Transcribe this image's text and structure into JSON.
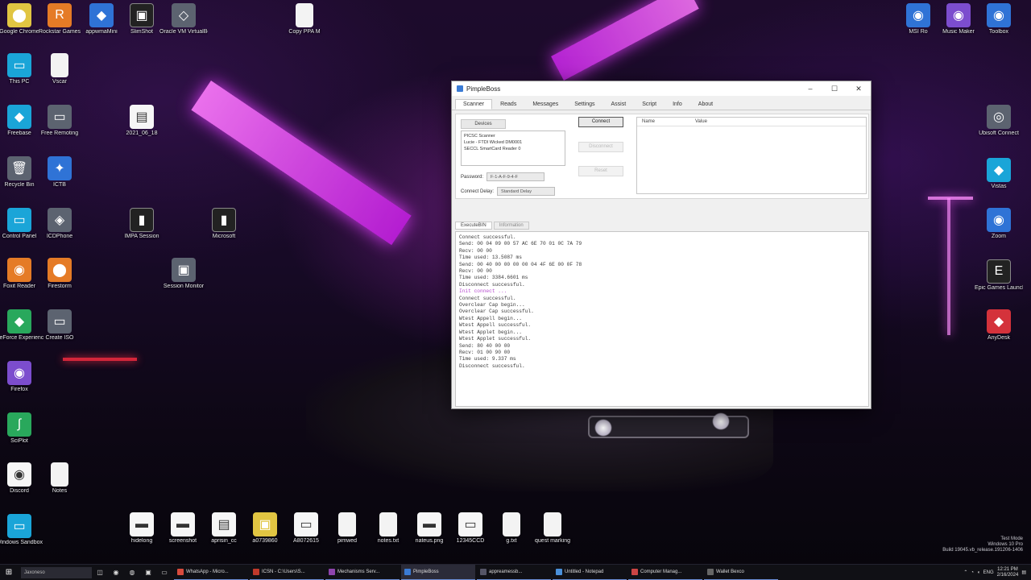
{
  "desktop": {
    "icons_left": [
      {
        "label": "Google Chrome",
        "glyph": "⬤",
        "color": "g-yellow"
      },
      {
        "label": "Rockstar Games",
        "glyph": "R",
        "color": "g-orange"
      },
      {
        "label": "appwmaMini",
        "glyph": "◆",
        "color": "g-blue"
      },
      {
        "label": "SlimShot",
        "glyph": "▣",
        "color": "g-dark"
      },
      {
        "label": "Oracle VM VirtualBox",
        "glyph": "◇",
        "color": "g-grey"
      },
      {
        "label": "This PC",
        "glyph": "▭",
        "color": "g-cyan"
      },
      {
        "label": "Vscar",
        "glyph": "",
        "color": "g-file"
      },
      {
        "label": "Freebase",
        "glyph": "◆",
        "color": "g-cyan"
      },
      {
        "label": "Free Remoting",
        "glyph": "▭",
        "color": "g-grey"
      },
      {
        "label": "2021_06_18",
        "glyph": "▤",
        "color": "g-white"
      },
      {
        "label": "Recycle Bin",
        "glyph": "🗑",
        "color": "g-grey"
      },
      {
        "label": "ICTB",
        "glyph": "✦",
        "color": "g-blue"
      },
      {
        "label": "Control Panel",
        "glyph": "▭",
        "color": "g-cyan"
      },
      {
        "label": "ICDPhone",
        "glyph": "◈",
        "color": "g-grey"
      },
      {
        "label": "IMPA Session",
        "glyph": "▮",
        "color": "g-dark"
      },
      {
        "label": "Microsoft",
        "glyph": "▮",
        "color": "g-dark"
      },
      {
        "label": "Foxit Reader",
        "glyph": "◉",
        "color": "g-orange"
      },
      {
        "label": "Firestorm",
        "glyph": "⬤",
        "color": "g-orange"
      },
      {
        "label": "Session Monitor",
        "glyph": "▣",
        "color": "g-grey"
      },
      {
        "label": "GeForce Experience",
        "glyph": "◆",
        "color": "g-green"
      },
      {
        "label": "Create ISO",
        "glyph": "▭",
        "color": "g-grey"
      },
      {
        "label": "Firefox",
        "glyph": "◉",
        "color": "g-purple"
      },
      {
        "label": "SciPlot",
        "glyph": "∫",
        "color": "g-green"
      },
      {
        "label": "Discord",
        "glyph": "◉",
        "color": "g-white"
      },
      {
        "label": "Notes",
        "glyph": "",
        "color": "g-file"
      },
      {
        "label": "Windows Sandbox",
        "glyph": "▭",
        "color": "g-cyan"
      },
      {
        "label": "Copy PPA M",
        "glyph": "",
        "color": "g-file"
      }
    ],
    "icons_right": [
      {
        "label": "MSI Ro",
        "glyph": "◉",
        "color": "g-blue"
      },
      {
        "label": "Music Maker",
        "glyph": "◉",
        "color": "g-purple"
      },
      {
        "label": "Toolbox",
        "glyph": "◉",
        "color": "g-blue"
      },
      {
        "label": "Ubisoft Connect",
        "glyph": "◎",
        "color": "g-grey"
      },
      {
        "label": "Vistas",
        "glyph": "◆",
        "color": "g-cyan"
      },
      {
        "label": "Zoom",
        "glyph": "◉",
        "color": "g-blue"
      },
      {
        "label": "Epic Games Launcher",
        "glyph": "E",
        "color": "g-dark"
      },
      {
        "label": "AnyDesk",
        "glyph": "◆",
        "color": "g-red"
      }
    ],
    "icons_bottom": [
      {
        "label": "hidelong",
        "glyph": "▬",
        "color": "g-white"
      },
      {
        "label": "screenshot",
        "glyph": "▬",
        "color": "g-white"
      },
      {
        "label": "aprisin_cc",
        "glyph": "▤",
        "color": "g-white"
      },
      {
        "label": "a0739860",
        "glyph": "▣",
        "color": "g-yellow"
      },
      {
        "label": "A8072615",
        "glyph": "▭",
        "color": "g-white"
      },
      {
        "label": "pimwed",
        "glyph": "",
        "color": "g-file"
      },
      {
        "label": "notes.txt",
        "glyph": "",
        "color": "g-file"
      },
      {
        "label": "nateus.png",
        "glyph": "▬",
        "color": "g-white"
      },
      {
        "label": "12345CCD",
        "glyph": "▭",
        "color": "g-white"
      },
      {
        "label": "g.txt",
        "glyph": "",
        "color": "g-file"
      },
      {
        "label": "quest marking",
        "glyph": "",
        "color": "g-file"
      }
    ]
  },
  "window": {
    "title": "PimpleBoss",
    "tabs": [
      "Scanner",
      "Reads",
      "Messages",
      "Settings",
      "Assist",
      "Script",
      "Info",
      "About"
    ],
    "subtab": "Devices",
    "device_list": [
      "PICSC Scanner",
      "Lucie - FTDI Wicked DM0001",
      "SECCL SmartCard Reader 0"
    ],
    "fields": [
      {
        "label": "Password:",
        "value": "F-1-A-F-9-4-F"
      },
      {
        "label": "Connect Delay:",
        "value": "Standard Delay"
      }
    ],
    "buttons": {
      "connect": "Connect",
      "ghost1": "Disconnect",
      "ghost2": "Reset"
    },
    "param_headers": [
      "Name",
      "Value"
    ],
    "log_tabs": [
      "ExecuteBIN",
      "Information"
    ],
    "log_lines": [
      {
        "text": "Connect successful.",
        "accent": false
      },
      {
        "text": "Send: 00 04 09 00 57 AC 6E 70 01 0C 7A 79",
        "accent": false
      },
      {
        "text": "Recv: 00 00",
        "accent": false
      },
      {
        "text": "Time used: 13.5087 ms",
        "accent": false
      },
      {
        "text": "Send: 00 40 00 00 00 00 04 4F 6E 00 0F 78",
        "accent": false
      },
      {
        "text": "Recv: 00 00",
        "accent": false
      },
      {
        "text": "Time used: 3384.6601 ms",
        "accent": false
      },
      {
        "text": "Disconnect successful.",
        "accent": false
      },
      {
        "text": "Init connect ...",
        "accent": true
      },
      {
        "text": "Connect successful.",
        "accent": false
      },
      {
        "text": "Overclear Cap begin...",
        "accent": false
      },
      {
        "text": "Overclear Cap successful.",
        "accent": false
      },
      {
        "text": "Wtest Appell begin...",
        "accent": false
      },
      {
        "text": "Wtest Appell successful.",
        "accent": false
      },
      {
        "text": "Wtest Applet begin...",
        "accent": false
      },
      {
        "text": "Wtest Applet successful.",
        "accent": false
      },
      {
        "text": "Send: 80 40 00 00",
        "accent": false
      },
      {
        "text": "Recv: 01 00 90 00",
        "accent": false
      },
      {
        "text": "Time used: 9.337 ms",
        "accent": false
      },
      {
        "text": "Disconnect successful.",
        "accent": false
      }
    ]
  },
  "taskbar": {
    "search_placeholder": "Jaxoneso",
    "apps": [
      {
        "label": "WhatsApp - Micro...",
        "color": "#d84b3d",
        "active": false
      },
      {
        "label": "ICSN - C:\\Users\\S...",
        "color": "#c0392b",
        "active": false
      },
      {
        "label": "Mechanisms Serv...",
        "color": "#8e44ad",
        "active": false
      },
      {
        "label": "PimpleBoss",
        "color": "#3a7bd5",
        "active": true
      },
      {
        "label": "appreamessb...",
        "color": "#556",
        "active": false
      },
      {
        "label": "Untitled - Notepad",
        "color": "#4a90d9",
        "active": false
      },
      {
        "label": "Computer Manag...",
        "color": "#c44",
        "active": false
      },
      {
        "label": "Wallet Bexco",
        "color": "#666",
        "active": false
      }
    ],
    "clock_time": "12:21 PM",
    "clock_date": "2/16/2024",
    "lang": "ENG"
  },
  "watermark": [
    "Test Mode",
    "Windows 10 Pro",
    "Build 19045.vb_release.191206-1406"
  ]
}
